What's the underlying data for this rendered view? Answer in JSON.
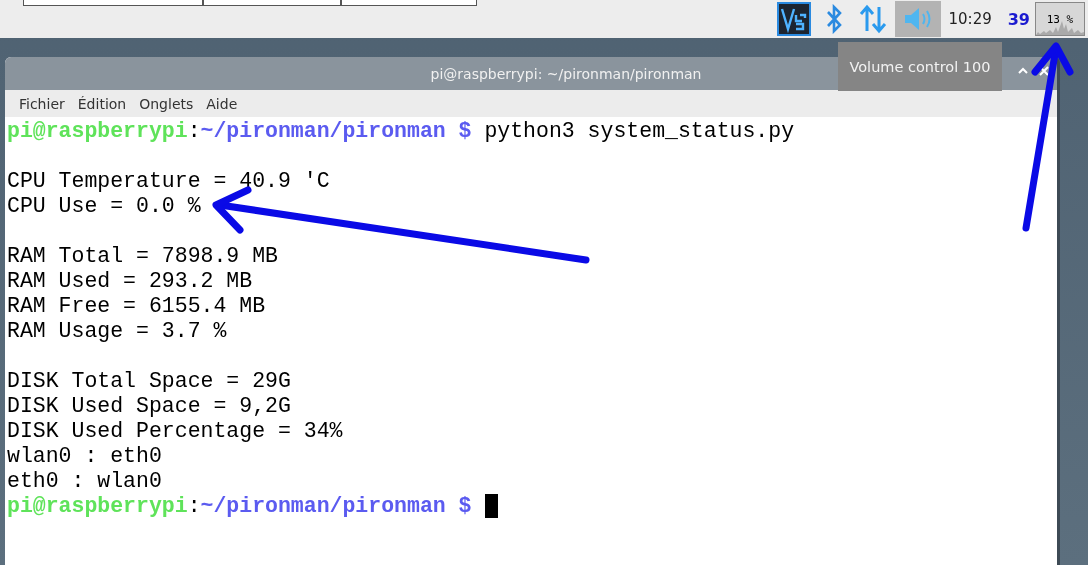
{
  "panel": {
    "tray_icons": [
      {
        "kind": "vnc",
        "active": false
      },
      {
        "kind": "bluetooth",
        "active": false
      },
      {
        "kind": "network",
        "active": false
      },
      {
        "kind": "volume",
        "active": true
      }
    ],
    "clock": "10:29",
    "temperature": "39",
    "cpu_monitor": {
      "reading": "13 %"
    }
  },
  "tooltip": {
    "text": "Volume control 100"
  },
  "window": {
    "title": "pi@raspberrypi: ~/pironman/pironman",
    "menu": [
      "Fichier",
      "Édition",
      "Onglets",
      "Aide"
    ],
    "terminal_lines": [
      {
        "kind": "prompt",
        "user": "pi@raspberrypi",
        "separator": ":",
        "path": "~/pironman/pironman",
        "symbol": "$",
        "command": "python3 system_status.py"
      },
      {
        "kind": "blank"
      },
      {
        "kind": "output",
        "text": "CPU Temperature = 40.9 'C"
      },
      {
        "kind": "output",
        "text": "CPU Use = 0.0 %"
      },
      {
        "kind": "blank"
      },
      {
        "kind": "output",
        "text": "RAM Total = 7898.9 MB"
      },
      {
        "kind": "output",
        "text": "RAM Used = 293.2 MB"
      },
      {
        "kind": "output",
        "text": "RAM Free = 6155.4 MB"
      },
      {
        "kind": "output",
        "text": "RAM Usage = 3.7 %"
      },
      {
        "kind": "blank"
      },
      {
        "kind": "output",
        "text": "DISK Total Space = 29G"
      },
      {
        "kind": "output",
        "text": "DISK Used Space = 9,2G"
      },
      {
        "kind": "output",
        "text": "DISK Used Percentage = 34%"
      },
      {
        "kind": "output",
        "text": "wlan0 : eth0"
      },
      {
        "kind": "output",
        "text": "eth0 : wlan0"
      },
      {
        "kind": "prompt",
        "user": "pi@raspberrypi",
        "separator": ":",
        "path": "~/pironman/pironman",
        "symbol": "$",
        "cursor": true
      }
    ]
  }
}
